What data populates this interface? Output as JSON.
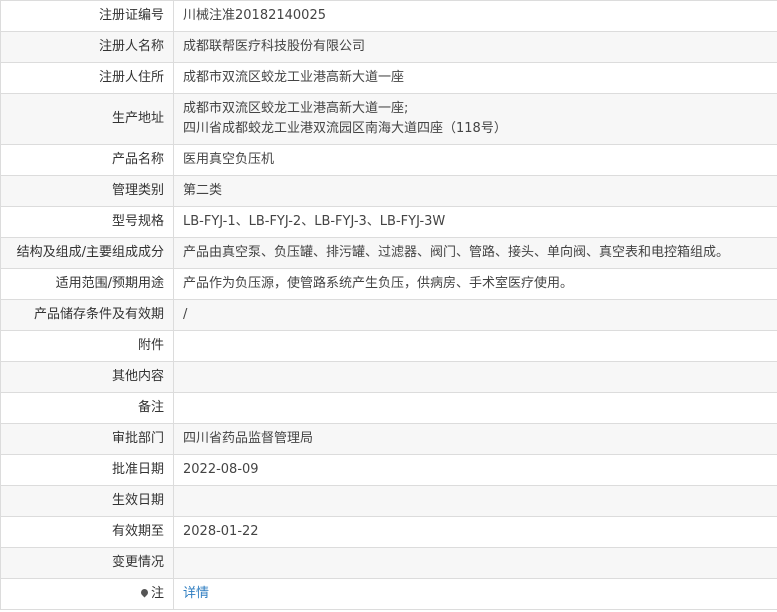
{
  "rows": [
    {
      "label": "注册证编号",
      "value": "川械注准20182140025"
    },
    {
      "label": "注册人名称",
      "value": "成都联帮医疗科技股份有限公司"
    },
    {
      "label": "注册人住所",
      "value": "成都市双流区蛟龙工业港高新大道一座"
    },
    {
      "label": "生产地址",
      "lines": [
        "成都市双流区蛟龙工业港高新大道一座;",
        "四川省成都蛟龙工业港双流园区南海大道四座（118号）"
      ]
    },
    {
      "label": "产品名称",
      "value": "医用真空负压机"
    },
    {
      "label": "管理类别",
      "value": "第二类"
    },
    {
      "label": "型号规格",
      "value": "LB-FYJ-1、LB-FYJ-2、LB-FYJ-3、LB-FYJ-3W"
    },
    {
      "label": "结构及组成/主要组成成分",
      "value": "产品由真空泵、负压罐、排污罐、过滤器、阀门、管路、接头、单向阀、真空表和电控箱组成。"
    },
    {
      "label": "适用范围/预期用途",
      "value": "产品作为负压源，使管路系统产生负压，供病房、手术室医疗使用。"
    },
    {
      "label": "产品储存条件及有效期",
      "value": "/"
    },
    {
      "label": "附件",
      "value": ""
    },
    {
      "label": "其他内容",
      "value": ""
    },
    {
      "label": "备注",
      "value": ""
    },
    {
      "label": "审批部门",
      "value": "四川省药品监督管理局"
    },
    {
      "label": "批准日期",
      "value": "2022-08-09"
    },
    {
      "label": "生效日期",
      "value": ""
    },
    {
      "label": "有效期至",
      "value": "2028-01-22"
    },
    {
      "label": "变更情况",
      "value": ""
    }
  ],
  "note": {
    "label": "注",
    "icon": "map-pin-icon",
    "link_text": "详情",
    "link_color": "#2f7ec1"
  }
}
